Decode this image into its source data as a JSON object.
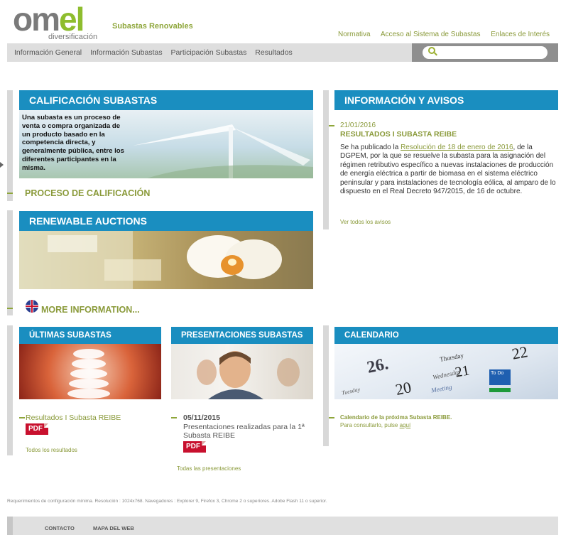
{
  "header": {
    "logo_text": "omel",
    "logo_sub": "diversificación",
    "tagline": "Subastas Renovables",
    "top_links": [
      "Normativa",
      "Acceso al Sistema de Subastas",
      "Enlaces de Interés"
    ]
  },
  "nav": {
    "items": [
      "Información General",
      "Información Subastas",
      "Participación Subastas",
      "Resultados"
    ],
    "search_value": ""
  },
  "calificacion": {
    "title": "CALIFICACIÓN SUBASTAS",
    "text": "Una subasta es un proceso de venta o compra organizada de un producto basado en la competencia directa, y generalmente pública, entre los diferentes participantes en la misma.",
    "link": "PROCESO DE CALIFICACIÓN"
  },
  "renewable": {
    "title": "RENEWABLE AUCTIONS",
    "link": "MORE INFORMATION..."
  },
  "avisos": {
    "title": "INFORMACIÓN Y AVISOS",
    "date": "21/01/2016",
    "headline": "RESULTADOS I SUBASTA REIBE",
    "body_pre": "Se ha publicado la ",
    "body_link": "Resolución de 18 de enero de 2016",
    "body_post": ", de la DGPEM, por la que se resuelve la subasta para la asignación del régimen retributivo específico a nuevas instalaciones de producción de energía eléctrica a partir de biomasa en el sistema eléctrico peninsular y para instalaciones de tecnología eólica, al amparo de lo dispuesto en el Real Decreto 947/2015, de 16 de octubre.",
    "more": "Ver todos los avisos"
  },
  "ultimas": {
    "title": "ÚLTIMAS SUBASTAS",
    "item": "Resultados I Subasta REIBE",
    "pdf": "PDF",
    "more": "Todos los resultados"
  },
  "presentaciones": {
    "title": "PRESENTACIONES SUBASTAS",
    "date": "05/11/2015",
    "item": "Presentaciones realizadas para la 1ª Subasta REIBE",
    "pdf": "PDF",
    "more": "Todas las presentaciones"
  },
  "calendario": {
    "title": "CALENDARIO",
    "cal_labels": [
      "26.",
      "Wednesday",
      "20",
      "Thursday",
      "21",
      "22",
      "Meeting",
      "To Do",
      "Tuesday"
    ],
    "item": "Calendario de la próxima Subasta REIBE.",
    "sub_pre": "Para consultarlo, pulse ",
    "sub_link": "aquí"
  },
  "footer": {
    "requirements": "Requerimientos de configuración mínima. Resolución : 1024x768. Navegadores : Explorer 9, Firefox 3, Chrome 2 o superiores. Adobe Flash 11 o superior.",
    "links": [
      "CONTACTO",
      "MAPA DEL WEB"
    ]
  }
}
